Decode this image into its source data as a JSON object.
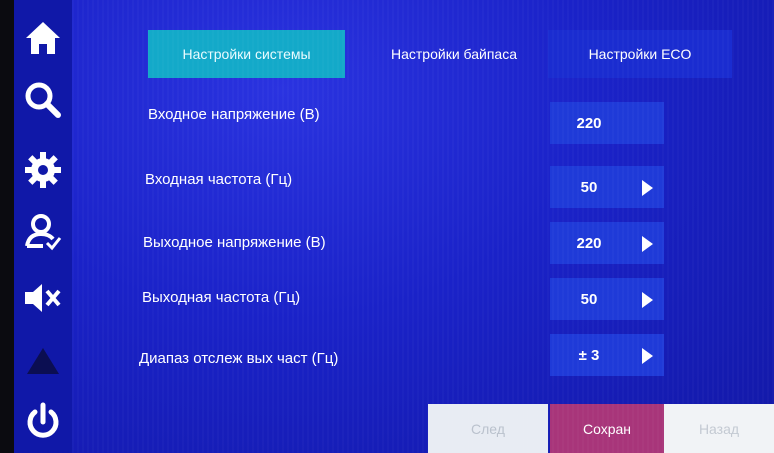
{
  "colors": {
    "sidebar": "#1018a8",
    "panel": "#1a22c8",
    "active_tab": "#13a9c9",
    "value_box": "#1f3ad8",
    "save_button": "#a8357a"
  },
  "sidebar": {
    "icons": [
      "home-icon",
      "search-icon",
      "gear-icon",
      "user-check-icon",
      "mute-icon",
      "warning-icon",
      "power-icon"
    ]
  },
  "tabs": [
    {
      "label": "Настройки системы",
      "active": true
    },
    {
      "label": "Настройки байпаса",
      "active": false
    },
    {
      "label": "Настройки ECO",
      "active": false
    }
  ],
  "settings": [
    {
      "label": "Входное напряжение (В)",
      "value": "220",
      "editable": false
    },
    {
      "label": "Входная частота (Гц)",
      "value": "50",
      "editable": true
    },
    {
      "label": "Выходное напряжение (В)",
      "value": "220",
      "editable": true
    },
    {
      "label": "Выходная частота (Гц)",
      "value": "50",
      "editable": true
    },
    {
      "label": "Диапаз отслеж вых част (Гц)",
      "value": "± 3",
      "editable": true
    }
  ],
  "buttons": {
    "next": "След",
    "save": "Сохран",
    "back": "Назад"
  }
}
